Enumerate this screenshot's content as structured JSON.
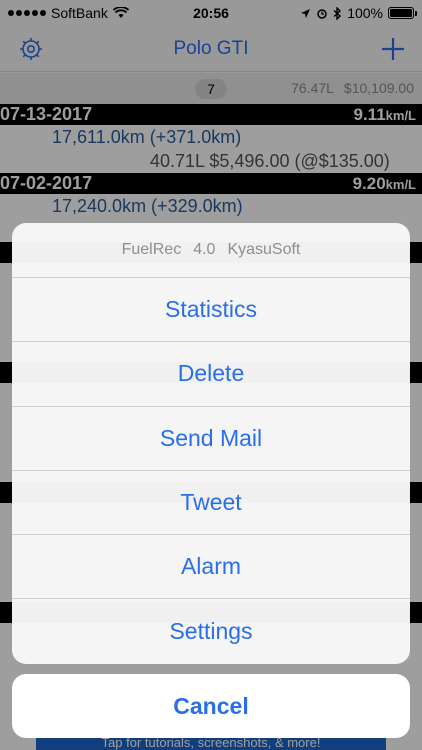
{
  "status_bar": {
    "carrier": "SoftBank",
    "time": "20:56",
    "battery": "100%"
  },
  "nav": {
    "title": "Polo GTI",
    "settings_icon": "gear-icon",
    "add_icon": "plus-icon"
  },
  "summary": {
    "count": "7",
    "volume": "76.47L",
    "cost": "$10,109.00"
  },
  "entries": [
    {
      "date": "07-13-2017",
      "efficiency": "9.11",
      "unit": "km/L",
      "odometer": "17,611.0km (+371.0km)",
      "fuel": "40.71L  $5,496.00 (@$135.00)"
    },
    {
      "date": "07-02-2017",
      "efficiency": "9.20",
      "unit": "km/L",
      "odometer": "17,240.0km (+329.0km)",
      "fuel": ""
    }
  ],
  "action_sheet": {
    "app_name": "FuelRec",
    "version": "4.0",
    "developer": "KyasuSoft",
    "actions": [
      "Statistics",
      "Delete",
      "Send Mail",
      "Tweet",
      "Alarm",
      "Settings"
    ],
    "cancel": "Cancel"
  },
  "banner": {
    "text": "Tap for tutorials, screenshots, & more!"
  },
  "colors": {
    "accent": "#2a6ee8",
    "date_bar": "#000000",
    "dim": "rgba(0,0,0,0.38)"
  }
}
